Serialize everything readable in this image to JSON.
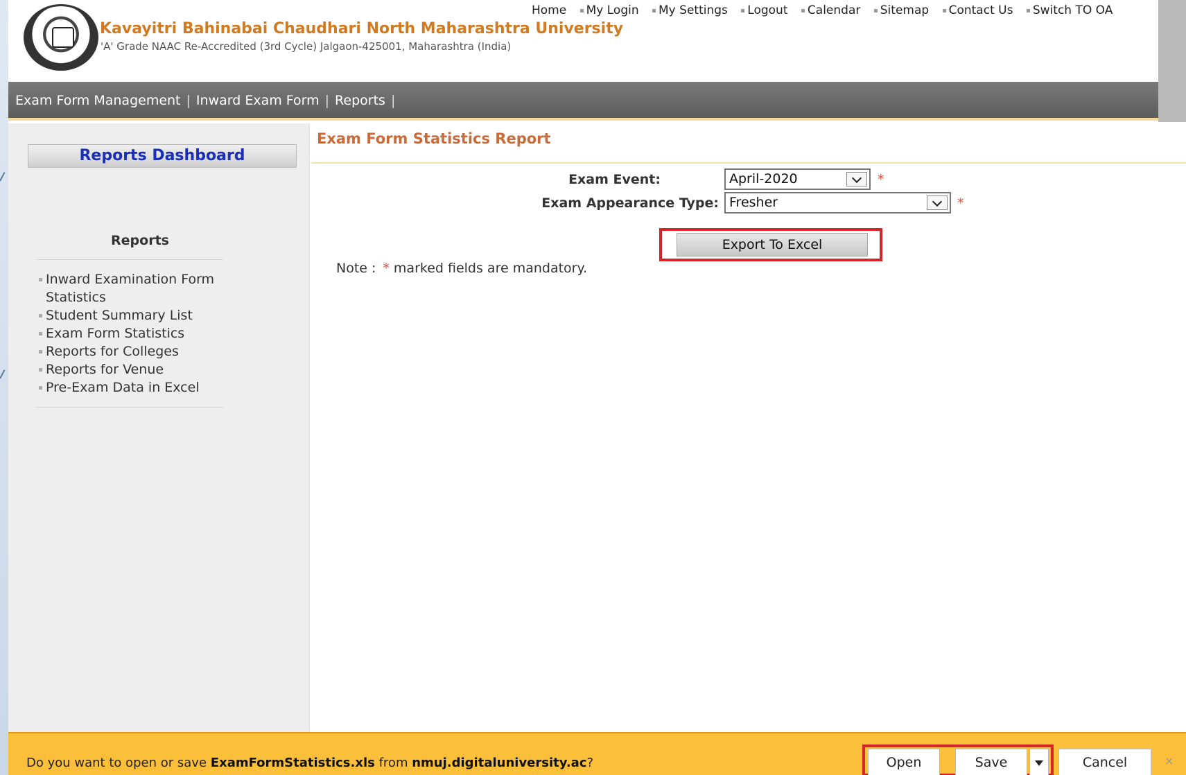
{
  "header": {
    "university_name": "Kavayitri Bahinabai Chaudhari North Maharashtra University",
    "subtitle": "'A' Grade NAAC Re-Accredited (3rd Cycle) Jalgaon-425001, Maharashtra (India)",
    "links": [
      "Home",
      "My Login",
      "My Settings",
      "Logout",
      "Calendar",
      "Sitemap",
      "Contact Us",
      "Switch TO OA"
    ]
  },
  "nav": {
    "items": [
      "Exam Form Management",
      "Inward Exam Form",
      "Reports"
    ],
    "separator": "|"
  },
  "sidebar": {
    "dashboard_label": "Reports Dashboard",
    "reports_title": "Reports",
    "items": [
      "Inward Examination Form Statistics",
      "Student Summary List",
      "Exam Form Statistics",
      "Reports for Colleges",
      "Reports for Venue",
      "Pre-Exam Data in Excel"
    ]
  },
  "main": {
    "title": "Exam Form Statistics Report",
    "exam_event_label": "Exam Event:",
    "exam_event_value": "April-2020",
    "appearance_label": "Exam Appearance Type:",
    "appearance_value": "Fresher",
    "required_mark": "*",
    "export_label": "Export To Excel",
    "note_prefix": "Note :",
    "note_star": "*",
    "note_text": "marked fields are mandatory."
  },
  "download_bar": {
    "prefix": "Do you want to open or save",
    "filename": "ExamFormStatistics.xls",
    "middle": "from",
    "domain": "nmuj.digitaluniversity.ac",
    "suffix": "?",
    "open_label": "Open",
    "save_label": "Save",
    "cancel_label": "Cancel",
    "close_symbol": "×"
  },
  "colors": {
    "accent_orange": "#d07a22",
    "title_orange": "#c86a3a",
    "dashboard_blue": "#1a2fb8",
    "required_red": "#e04b3b",
    "highlight_red": "#d7262b",
    "download_bar": "#fbbf39"
  }
}
